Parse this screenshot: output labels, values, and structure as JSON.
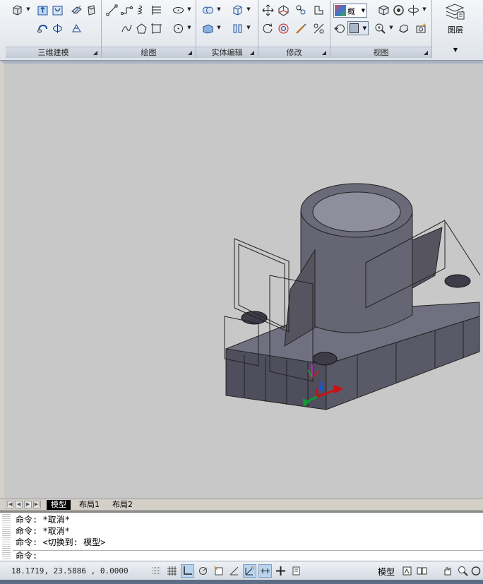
{
  "ribbon": {
    "panels": [
      {
        "title": "三维建模"
      },
      {
        "title": "绘图"
      },
      {
        "title": "实体编辑"
      },
      {
        "title": "修改"
      },
      {
        "title": "视图"
      }
    ],
    "visual_style": {
      "label": "概"
    },
    "layers_label": "图层"
  },
  "tabs": {
    "items": [
      {
        "label": "模型",
        "active": true
      },
      {
        "label": "布局1",
        "active": false
      },
      {
        "label": "布局2",
        "active": false
      }
    ]
  },
  "command": {
    "history": [
      "命令: *取消*",
      "命令: *取消*",
      "命令:  <切换到: 模型>"
    ],
    "prompt": "命令:"
  },
  "status": {
    "coordinates": "18.1719, 23.5886 , 0.0000",
    "model_label": "模型",
    "toggles": [
      {
        "name": "infer-constraints",
        "on": false
      },
      {
        "name": "grid",
        "on": false
      },
      {
        "name": "ortho",
        "on": true
      },
      {
        "name": "polar",
        "on": false
      },
      {
        "name": "object-snap",
        "on": false
      },
      {
        "name": "object-snap-tracking",
        "on": false
      },
      {
        "name": "dynamic-ucs",
        "on": true
      },
      {
        "name": "dynamic-input",
        "on": true
      },
      {
        "name": "lineweight",
        "on": false
      },
      {
        "name": "quick-properties",
        "on": false
      }
    ]
  },
  "colors": {
    "viewport_bg": "#c8c8c8",
    "solid_dark": "#5e5d6b",
    "solid_light": "#8b8a97",
    "ucs_x": "#cc1111",
    "ucs_y": "#119933"
  }
}
